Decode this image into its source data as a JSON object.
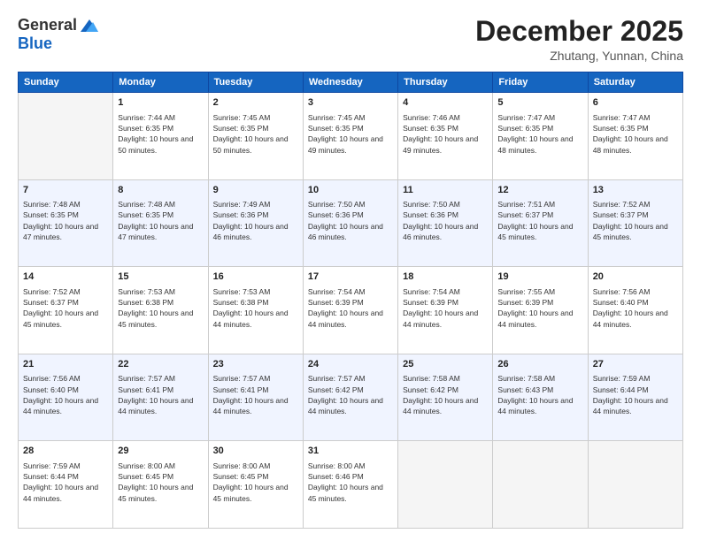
{
  "logo": {
    "general": "General",
    "blue": "Blue"
  },
  "title": "December 2025",
  "location": "Zhutang, Yunnan, China",
  "weekdays": [
    "Sunday",
    "Monday",
    "Tuesday",
    "Wednesday",
    "Thursday",
    "Friday",
    "Saturday"
  ],
  "weeks": [
    [
      {
        "day": "",
        "sunrise": "",
        "sunset": "",
        "daylight": ""
      },
      {
        "day": "1",
        "sunrise": "Sunrise: 7:44 AM",
        "sunset": "Sunset: 6:35 PM",
        "daylight": "Daylight: 10 hours and 50 minutes."
      },
      {
        "day": "2",
        "sunrise": "Sunrise: 7:45 AM",
        "sunset": "Sunset: 6:35 PM",
        "daylight": "Daylight: 10 hours and 50 minutes."
      },
      {
        "day": "3",
        "sunrise": "Sunrise: 7:45 AM",
        "sunset": "Sunset: 6:35 PM",
        "daylight": "Daylight: 10 hours and 49 minutes."
      },
      {
        "day": "4",
        "sunrise": "Sunrise: 7:46 AM",
        "sunset": "Sunset: 6:35 PM",
        "daylight": "Daylight: 10 hours and 49 minutes."
      },
      {
        "day": "5",
        "sunrise": "Sunrise: 7:47 AM",
        "sunset": "Sunset: 6:35 PM",
        "daylight": "Daylight: 10 hours and 48 minutes."
      },
      {
        "day": "6",
        "sunrise": "Sunrise: 7:47 AM",
        "sunset": "Sunset: 6:35 PM",
        "daylight": "Daylight: 10 hours and 48 minutes."
      }
    ],
    [
      {
        "day": "7",
        "sunrise": "Sunrise: 7:48 AM",
        "sunset": "Sunset: 6:35 PM",
        "daylight": "Daylight: 10 hours and 47 minutes."
      },
      {
        "day": "8",
        "sunrise": "Sunrise: 7:48 AM",
        "sunset": "Sunset: 6:35 PM",
        "daylight": "Daylight: 10 hours and 47 minutes."
      },
      {
        "day": "9",
        "sunrise": "Sunrise: 7:49 AM",
        "sunset": "Sunset: 6:36 PM",
        "daylight": "Daylight: 10 hours and 46 minutes."
      },
      {
        "day": "10",
        "sunrise": "Sunrise: 7:50 AM",
        "sunset": "Sunset: 6:36 PM",
        "daylight": "Daylight: 10 hours and 46 minutes."
      },
      {
        "day": "11",
        "sunrise": "Sunrise: 7:50 AM",
        "sunset": "Sunset: 6:36 PM",
        "daylight": "Daylight: 10 hours and 46 minutes."
      },
      {
        "day": "12",
        "sunrise": "Sunrise: 7:51 AM",
        "sunset": "Sunset: 6:37 PM",
        "daylight": "Daylight: 10 hours and 45 minutes."
      },
      {
        "day": "13",
        "sunrise": "Sunrise: 7:52 AM",
        "sunset": "Sunset: 6:37 PM",
        "daylight": "Daylight: 10 hours and 45 minutes."
      }
    ],
    [
      {
        "day": "14",
        "sunrise": "Sunrise: 7:52 AM",
        "sunset": "Sunset: 6:37 PM",
        "daylight": "Daylight: 10 hours and 45 minutes."
      },
      {
        "day": "15",
        "sunrise": "Sunrise: 7:53 AM",
        "sunset": "Sunset: 6:38 PM",
        "daylight": "Daylight: 10 hours and 45 minutes."
      },
      {
        "day": "16",
        "sunrise": "Sunrise: 7:53 AM",
        "sunset": "Sunset: 6:38 PM",
        "daylight": "Daylight: 10 hours and 44 minutes."
      },
      {
        "day": "17",
        "sunrise": "Sunrise: 7:54 AM",
        "sunset": "Sunset: 6:39 PM",
        "daylight": "Daylight: 10 hours and 44 minutes."
      },
      {
        "day": "18",
        "sunrise": "Sunrise: 7:54 AM",
        "sunset": "Sunset: 6:39 PM",
        "daylight": "Daylight: 10 hours and 44 minutes."
      },
      {
        "day": "19",
        "sunrise": "Sunrise: 7:55 AM",
        "sunset": "Sunset: 6:39 PM",
        "daylight": "Daylight: 10 hours and 44 minutes."
      },
      {
        "day": "20",
        "sunrise": "Sunrise: 7:56 AM",
        "sunset": "Sunset: 6:40 PM",
        "daylight": "Daylight: 10 hours and 44 minutes."
      }
    ],
    [
      {
        "day": "21",
        "sunrise": "Sunrise: 7:56 AM",
        "sunset": "Sunset: 6:40 PM",
        "daylight": "Daylight: 10 hours and 44 minutes."
      },
      {
        "day": "22",
        "sunrise": "Sunrise: 7:57 AM",
        "sunset": "Sunset: 6:41 PM",
        "daylight": "Daylight: 10 hours and 44 minutes."
      },
      {
        "day": "23",
        "sunrise": "Sunrise: 7:57 AM",
        "sunset": "Sunset: 6:41 PM",
        "daylight": "Daylight: 10 hours and 44 minutes."
      },
      {
        "day": "24",
        "sunrise": "Sunrise: 7:57 AM",
        "sunset": "Sunset: 6:42 PM",
        "daylight": "Daylight: 10 hours and 44 minutes."
      },
      {
        "day": "25",
        "sunrise": "Sunrise: 7:58 AM",
        "sunset": "Sunset: 6:42 PM",
        "daylight": "Daylight: 10 hours and 44 minutes."
      },
      {
        "day": "26",
        "sunrise": "Sunrise: 7:58 AM",
        "sunset": "Sunset: 6:43 PM",
        "daylight": "Daylight: 10 hours and 44 minutes."
      },
      {
        "day": "27",
        "sunrise": "Sunrise: 7:59 AM",
        "sunset": "Sunset: 6:44 PM",
        "daylight": "Daylight: 10 hours and 44 minutes."
      }
    ],
    [
      {
        "day": "28",
        "sunrise": "Sunrise: 7:59 AM",
        "sunset": "Sunset: 6:44 PM",
        "daylight": "Daylight: 10 hours and 44 minutes."
      },
      {
        "day": "29",
        "sunrise": "Sunrise: 8:00 AM",
        "sunset": "Sunset: 6:45 PM",
        "daylight": "Daylight: 10 hours and 45 minutes."
      },
      {
        "day": "30",
        "sunrise": "Sunrise: 8:00 AM",
        "sunset": "Sunset: 6:45 PM",
        "daylight": "Daylight: 10 hours and 45 minutes."
      },
      {
        "day": "31",
        "sunrise": "Sunrise: 8:00 AM",
        "sunset": "Sunset: 6:46 PM",
        "daylight": "Daylight: 10 hours and 45 minutes."
      },
      {
        "day": "",
        "sunrise": "",
        "sunset": "",
        "daylight": ""
      },
      {
        "day": "",
        "sunrise": "",
        "sunset": "",
        "daylight": ""
      },
      {
        "day": "",
        "sunrise": "",
        "sunset": "",
        "daylight": ""
      }
    ]
  ]
}
